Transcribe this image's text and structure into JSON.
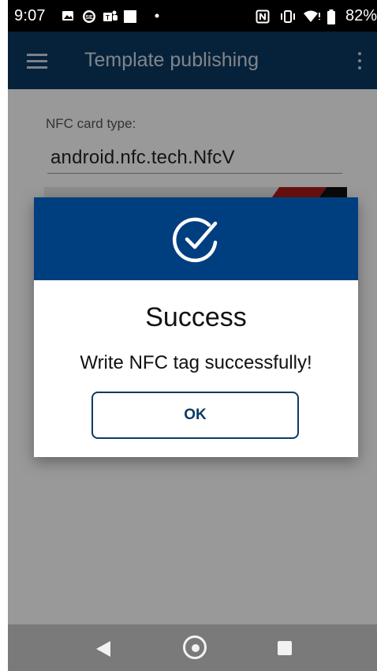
{
  "status_bar": {
    "time": "9:07",
    "battery": "82%",
    "icons": [
      "image-icon",
      "se-icon",
      "teams-icon",
      "white-square-icon",
      "dot-icon",
      "nfc-icon",
      "vibrate-icon",
      "wifi-icon",
      "battery-icon"
    ]
  },
  "app_bar": {
    "title": "Template publishing",
    "menu_icon": "hamburger-icon",
    "overflow_icon": "more-vertical-icon"
  },
  "form": {
    "nfc_label": "NFC card type:",
    "nfc_value": "android.nfc.tech.NfcV"
  },
  "dialog": {
    "icon": "check-circle-icon",
    "title": "Success",
    "message": "Write NFC tag successfully!",
    "ok_label": "OK"
  },
  "nav_bar": {
    "icons": [
      "back-icon",
      "home-icon",
      "recents-icon"
    ]
  },
  "colors": {
    "app_bar": "#0b3a63",
    "dialog_header": "#003f7f",
    "accent": "#0b3a63"
  }
}
